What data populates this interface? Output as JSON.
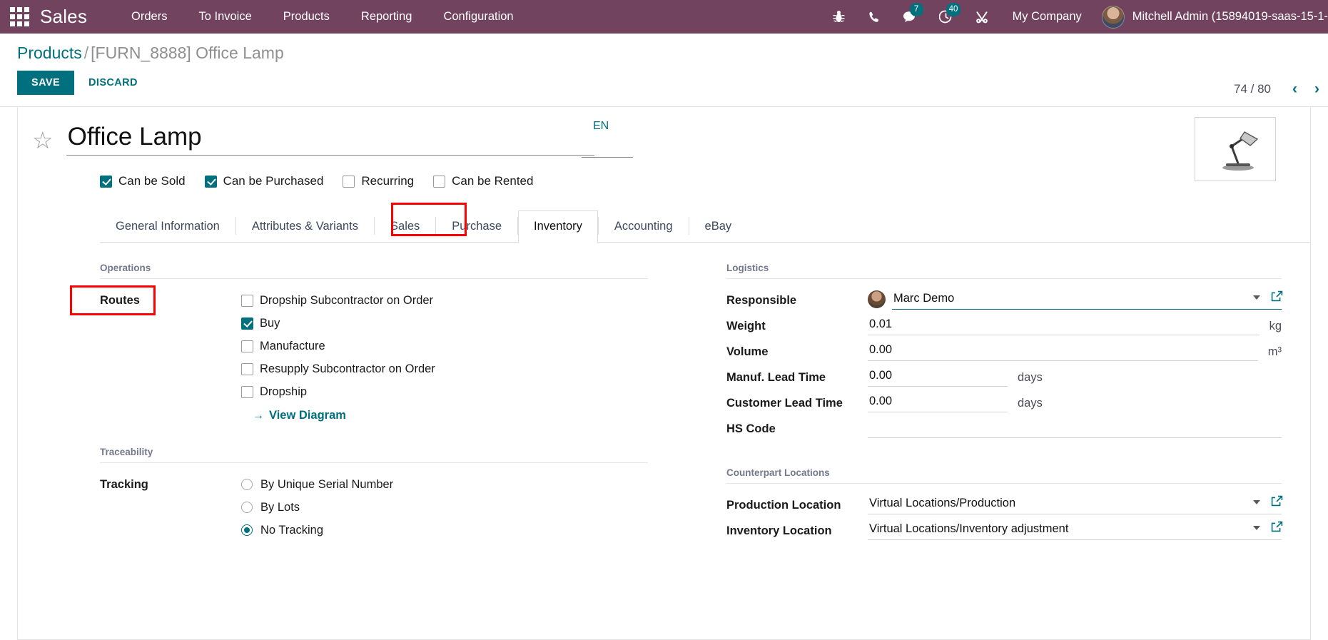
{
  "navbar": {
    "apps_icon": "apps-grid-icon",
    "brand": "Sales",
    "menu": [
      "Orders",
      "To Invoice",
      "Products",
      "Reporting",
      "Configuration"
    ],
    "icons": [
      {
        "name": "bug-icon",
        "badge": null
      },
      {
        "name": "phone-icon",
        "badge": null
      },
      {
        "name": "messages-icon",
        "badge": "7"
      },
      {
        "name": "activities-clock-icon",
        "badge": "40"
      },
      {
        "name": "tools-icon",
        "badge": null
      }
    ],
    "company": "My Company",
    "user": "Mitchell Admin (15894019-saas-15-1-"
  },
  "control_panel": {
    "breadcrumb_root": "Products",
    "breadcrumb_separator": "/",
    "breadcrumb_current": "[FURN_8888] Office Lamp",
    "save_label": "SAVE",
    "discard_label": "DISCARD",
    "pager_text": "74 / 80",
    "pager_prev": "‹",
    "pager_next": "›"
  },
  "form": {
    "star_icon": "star-outline-icon",
    "product_name": "Office Lamp",
    "language_tag": "EN",
    "product_image_alt": "office-lamp-thumbnail",
    "checkboxes": [
      {
        "label": "Can be Sold",
        "checked": true
      },
      {
        "label": "Can be Purchased",
        "checked": true
      },
      {
        "label": "Recurring",
        "checked": false
      },
      {
        "label": "Can be Rented",
        "checked": false
      }
    ],
    "tabs": [
      {
        "label": "General Information",
        "active": false
      },
      {
        "label": "Attributes & Variants",
        "active": false
      },
      {
        "label": "Sales",
        "active": false
      },
      {
        "label": "Purchase",
        "active": false
      },
      {
        "label": "Inventory",
        "active": true
      },
      {
        "label": "Accounting",
        "active": false
      },
      {
        "label": "eBay",
        "active": false
      }
    ],
    "operations": {
      "group_title": "Operations",
      "routes_label": "Routes",
      "routes": [
        {
          "label": "Dropship Subcontractor on Order",
          "checked": false
        },
        {
          "label": "Buy",
          "checked": true
        },
        {
          "label": "Manufacture",
          "checked": false
        },
        {
          "label": "Resupply Subcontractor on Order",
          "checked": false
        },
        {
          "label": "Dropship",
          "checked": false
        }
      ],
      "view_diagram_label": "View Diagram",
      "view_diagram_arrow": "→"
    },
    "traceability": {
      "group_title": "Traceability",
      "tracking_label": "Tracking",
      "options": [
        {
          "label": "By Unique Serial Number",
          "selected": false
        },
        {
          "label": "By Lots",
          "selected": false
        },
        {
          "label": "No Tracking",
          "selected": true
        }
      ]
    },
    "logistics": {
      "group_title": "Logistics",
      "fields": [
        {
          "label": "Responsible",
          "value": "Marc Demo",
          "unit": "",
          "has_avatar": true,
          "has_caret": true,
          "has_external": true,
          "focused": true
        },
        {
          "label": "Weight",
          "value": "0.01",
          "unit": "kg",
          "has_avatar": false,
          "has_caret": false,
          "has_external": false,
          "focused": false
        },
        {
          "label": "Volume",
          "value": "0.00",
          "unit": "m³",
          "has_avatar": false,
          "has_caret": false,
          "has_external": false,
          "focused": false
        },
        {
          "label": "Manuf. Lead Time",
          "value": "0.00",
          "unit": "days",
          "has_avatar": false,
          "has_caret": false,
          "has_external": false,
          "focused": false
        },
        {
          "label": "Customer Lead Time",
          "value": "0.00",
          "unit": "days",
          "has_avatar": false,
          "has_caret": false,
          "has_external": false,
          "focused": false
        },
        {
          "label": "HS Code",
          "value": "",
          "unit": "",
          "has_avatar": false,
          "has_caret": false,
          "has_external": false,
          "focused": false
        }
      ]
    },
    "counterpart": {
      "group_title": "Counterpart Locations",
      "fields": [
        {
          "label": "Production Location",
          "value": "Virtual Locations/Production",
          "has_caret": true,
          "has_external": true
        },
        {
          "label": "Inventory Location",
          "value": "Virtual Locations/Inventory adjustment",
          "has_caret": true,
          "has_external": true
        }
      ]
    }
  },
  "annotations": {
    "inventory_tab_highlight_color": "#ff0000",
    "routes_highlight_color": "#ff0000"
  },
  "colors": {
    "navbar": "#71435f",
    "accent_teal": "#00707f",
    "badge": "#00707f",
    "annotation_red": "#ff0000"
  }
}
